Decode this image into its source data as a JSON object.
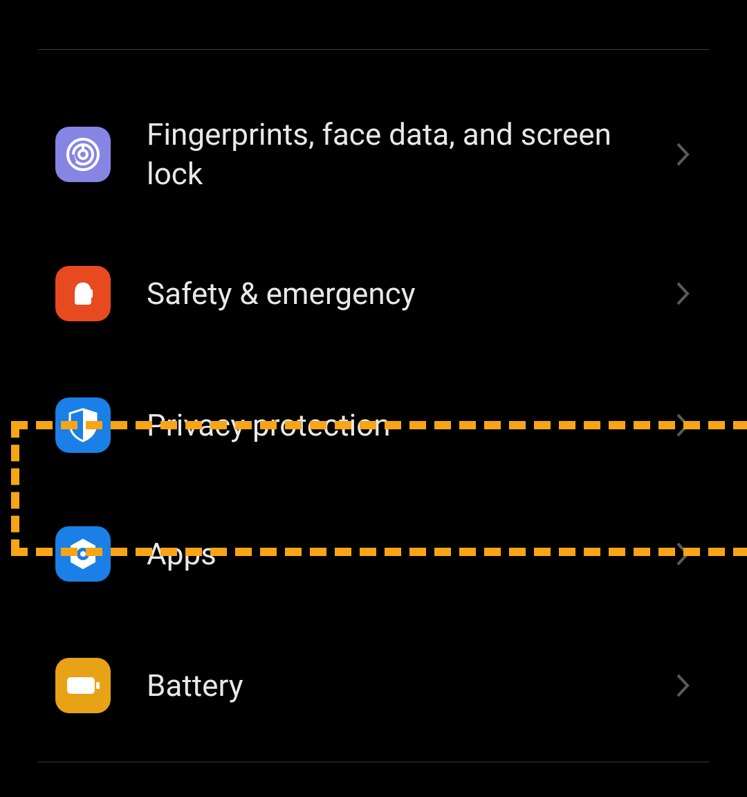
{
  "settings": {
    "items": [
      {
        "id": "fingerprint",
        "label": "Fingerprints, face data, and screen lock",
        "icon": "fingerprint-icon",
        "icon_bg": "#8685e4"
      },
      {
        "id": "safety",
        "label": "Safety & emergency",
        "icon": "bell-icon",
        "icon_bg": "#e74a1f"
      },
      {
        "id": "privacy",
        "label": "Privacy protection",
        "icon": "shield-icon",
        "icon_bg": "#1a7fe6"
      },
      {
        "id": "apps",
        "label": "Apps",
        "icon": "hexagon-gear-icon",
        "icon_bg": "#1a7fe6",
        "highlighted": true
      },
      {
        "id": "battery",
        "label": "Battery",
        "icon": "battery-icon",
        "icon_bg": "#e8a216"
      }
    ]
  },
  "highlight": {
    "color": "#f7a516",
    "target": "apps"
  }
}
